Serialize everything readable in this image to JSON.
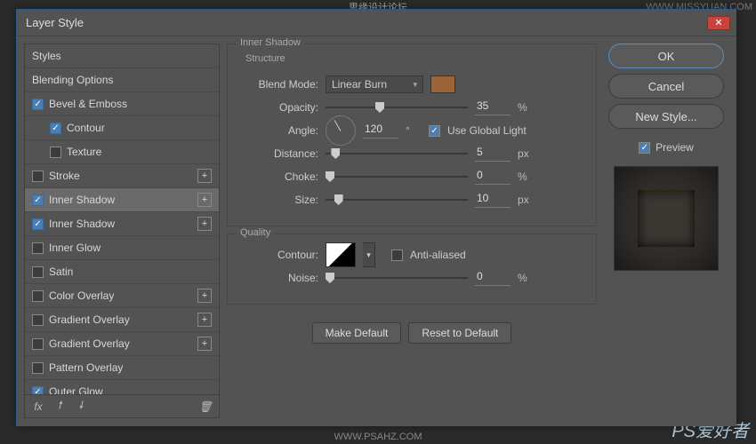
{
  "watermarks": {
    "topRight": "WWW.MISSYUAN.COM",
    "topCenter": "思缘设计论坛",
    "bottomCenter": "WWW.PSAHZ.COM",
    "bottomRightA": "PS",
    "bottomRightB": "爱好者"
  },
  "dialog": {
    "title": "Layer Style"
  },
  "styleList": {
    "items": [
      {
        "label": "Styles",
        "hasCheckbox": false
      },
      {
        "label": "Blending Options",
        "hasCheckbox": false
      },
      {
        "label": "Bevel & Emboss",
        "hasCheckbox": true,
        "checked": true
      },
      {
        "label": "Contour",
        "hasCheckbox": true,
        "checked": true,
        "indent": true
      },
      {
        "label": "Texture",
        "hasCheckbox": true,
        "checked": false,
        "indent": true
      },
      {
        "label": "Stroke",
        "hasCheckbox": true,
        "checked": false,
        "plus": true
      },
      {
        "label": "Inner Shadow",
        "hasCheckbox": true,
        "checked": true,
        "plus": true,
        "selected": true
      },
      {
        "label": "Inner Shadow",
        "hasCheckbox": true,
        "checked": true,
        "plus": true
      },
      {
        "label": "Inner Glow",
        "hasCheckbox": true,
        "checked": false
      },
      {
        "label": "Satin",
        "hasCheckbox": true,
        "checked": false
      },
      {
        "label": "Color Overlay",
        "hasCheckbox": true,
        "checked": false,
        "plus": true
      },
      {
        "label": "Gradient Overlay",
        "hasCheckbox": true,
        "checked": false,
        "plus": true
      },
      {
        "label": "Gradient Overlay",
        "hasCheckbox": true,
        "checked": false,
        "plus": true
      },
      {
        "label": "Pattern Overlay",
        "hasCheckbox": true,
        "checked": false
      },
      {
        "label": "Outer Glow",
        "hasCheckbox": true,
        "checked": true
      }
    ],
    "footer": {
      "fx": "fx"
    }
  },
  "panel": {
    "title": "Inner Shadow",
    "structure": {
      "title": "Structure",
      "blendMode": {
        "label": "Blend Mode:",
        "value": "Linear Burn",
        "color": "#9c6438"
      },
      "opacity": {
        "label": "Opacity:",
        "value": "35",
        "unit": "%",
        "pos": 35
      },
      "angle": {
        "label": "Angle:",
        "value": "120",
        "unit": "°",
        "globalLabel": "Use Global Light",
        "globalChecked": true,
        "rot": -120
      },
      "distance": {
        "label": "Distance:",
        "value": "5",
        "unit": "px",
        "pos": 4
      },
      "choke": {
        "label": "Choke:",
        "value": "0",
        "unit": "%",
        "pos": 0
      },
      "size": {
        "label": "Size:",
        "value": "10",
        "unit": "px",
        "pos": 6
      }
    },
    "quality": {
      "title": "Quality",
      "contour": {
        "label": "Contour:",
        "antiAliasLabel": "Anti-aliased",
        "antiAliasChecked": false
      },
      "noise": {
        "label": "Noise:",
        "value": "0",
        "unit": "%",
        "pos": 0
      }
    },
    "buttons": {
      "makeDefault": "Make Default",
      "reset": "Reset to Default"
    }
  },
  "right": {
    "ok": "OK",
    "cancel": "Cancel",
    "newStyle": "New Style...",
    "preview": {
      "label": "Preview",
      "checked": true
    }
  }
}
